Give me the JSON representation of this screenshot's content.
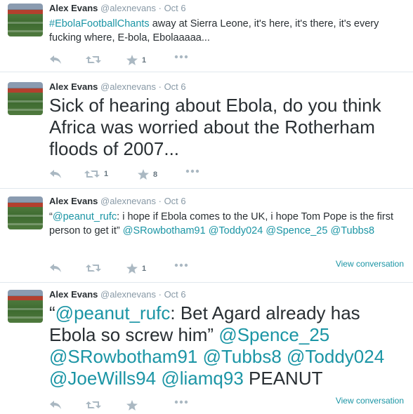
{
  "tweets": [
    {
      "name": "Alex Evans",
      "handle": "@alexnevans",
      "dot": "·",
      "time": "Oct 6",
      "segments": [
        {
          "t": "#EbolaFootballChants",
          "link": true
        },
        {
          "t": " away at Sierra Leone, it's here, it's there, it's every fucking where, E-bola, Ebolaaaaa...",
          "link": false
        }
      ],
      "retweets": "",
      "favorites": "1",
      "view_conversation": ""
    },
    {
      "name": "Alex Evans",
      "handle": "@alexnevans",
      "dot": "·",
      "time": "Oct 6",
      "segments": [
        {
          "t": "Sick of hearing about Ebola, do you think Africa was worried about the Rotherham floods of 2007...",
          "link": false
        }
      ],
      "retweets": "1",
      "favorites": "8",
      "view_conversation": ""
    },
    {
      "name": "Alex Evans",
      "handle": "@alexnevans",
      "dot": "·",
      "time": "Oct 6",
      "segments": [
        {
          "t": "“",
          "link": false
        },
        {
          "t": "@peanut_rufc",
          "link": true
        },
        {
          "t": ": i hope if Ebola comes to the UK, i hope Tom Pope is the first person to get it” ",
          "link": false
        },
        {
          "t": "@SRowbotham91",
          "link": true
        },
        {
          "t": " ",
          "link": false
        },
        {
          "t": "@Toddy024",
          "link": true
        },
        {
          "t": " ",
          "link": false
        },
        {
          "t": "@Spence_25",
          "link": true
        },
        {
          "t": " ",
          "link": false
        },
        {
          "t": "@Tubbs8",
          "link": true
        }
      ],
      "retweets": "",
      "favorites": "1",
      "view_conversation": "View conversation"
    },
    {
      "name": "Alex Evans",
      "handle": "@alexnevans",
      "dot": "·",
      "time": "Oct 6",
      "segments": [
        {
          "t": "“",
          "link": false
        },
        {
          "t": "@peanut_rufc",
          "link": true
        },
        {
          "t": ": Bet Agard already has Ebola so screw him” ",
          "link": false
        },
        {
          "t": "@Spence_25",
          "link": true
        },
        {
          "t": " ",
          "link": false
        },
        {
          "t": "@SRowbotham91",
          "link": true
        },
        {
          "t": " ",
          "link": false
        },
        {
          "t": "@Tubbs8",
          "link": true
        },
        {
          "t": " ",
          "link": false
        },
        {
          "t": "@Toddy024",
          "link": true
        },
        {
          "t": " ",
          "link": false
        },
        {
          "t": "@JoeWills94",
          "link": true
        },
        {
          "t": " ",
          "link": false
        },
        {
          "t": "@liamq93",
          "link": true
        },
        {
          "t": " PEANUT",
          "link": false
        }
      ],
      "retweets": "",
      "favorites": "",
      "view_conversation": "View conversation"
    }
  ],
  "icons": {
    "reply": "reply-icon",
    "retweet": "retweet-icon",
    "favorite": "star-icon",
    "more": "more-icon"
  },
  "colors": {
    "link": "#1b95a5",
    "action": "#aab8c2",
    "meta": "#8899a6"
  }
}
